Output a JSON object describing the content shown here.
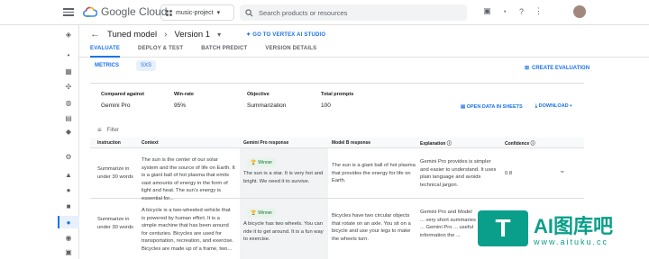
{
  "topbar": {
    "logo_text": "Google Cloud",
    "project": "music-project",
    "search_placeholder": "Search products or resources"
  },
  "header": {
    "title": "Tuned model",
    "version": "Version 1",
    "vertex_link": "GO TO VERTEX AI STUDIO"
  },
  "tabs": [
    "EVALUATE",
    "DEPLOY & TEST",
    "BATCH PREDICT",
    "VERSION DETAILS"
  ],
  "subtabs": [
    "METRICS",
    "SXS"
  ],
  "create_eval": "CREATE EVALUATION",
  "summary": {
    "compared_label": "Compared against",
    "compared_value": "Gemini Pro",
    "winrate_label": "Win-rate",
    "winrate_value": "95%",
    "objective_label": "Objective",
    "objective_value": "Summarization",
    "prompts_label": "Total prompts",
    "prompts_value": "100",
    "open_sheets": "OPEN DATA IN SHEETS",
    "download": "DOWNLOAD"
  },
  "filter_label": "Filter",
  "table": {
    "headers": [
      "Instruction",
      "Context",
      "Gemini Pro response",
      "Model B response",
      "Explanation",
      "Confidence"
    ],
    "rows": [
      {
        "instruction": "Summarize in under 30 words",
        "context": "The sun is the center of our solar system and the source of life on Earth. It is a giant ball of hot plasma that emits vast amounts of energy in the form of light and heat. The sun's energy is essential for...",
        "winner": "Winner",
        "gemini": "The sun is a star. It is very hot and bright. We need it to survive.",
        "model_b": "The sun is a giant ball of hot plasma that provides the energy for life on Earth.",
        "explanation": "Gemini Pro provides is simpler and easier to understand. It uses plain language and avoids technical jargon.",
        "confidence": "0.8"
      },
      {
        "instruction": "Summarize in under 30 words",
        "context": "A bicycle is a two-wheeled vehicle that is powered by human effort. It is a simple machine that has been around for centuries. Bicycles are used for transportation, recreation, and exercise. Bicycles are made up of a frame, two...",
        "winner": "Winner",
        "gemini": "A bicycle has two wheels. You can ride it to get around. It is a fun way to exercise.",
        "model_b": "Bicycles have two circular objects that rotate on an axle. You sit on a bicycle and use your legs to make the wheels turn.",
        "explanation": "Gemini Pro and Model ... very short summaries ... Gemini Pro ... useful information the ...",
        "confidence": ""
      }
    ]
  },
  "watermark": {
    "brand": "AI图库吧",
    "url": "www.aituku.cc"
  }
}
